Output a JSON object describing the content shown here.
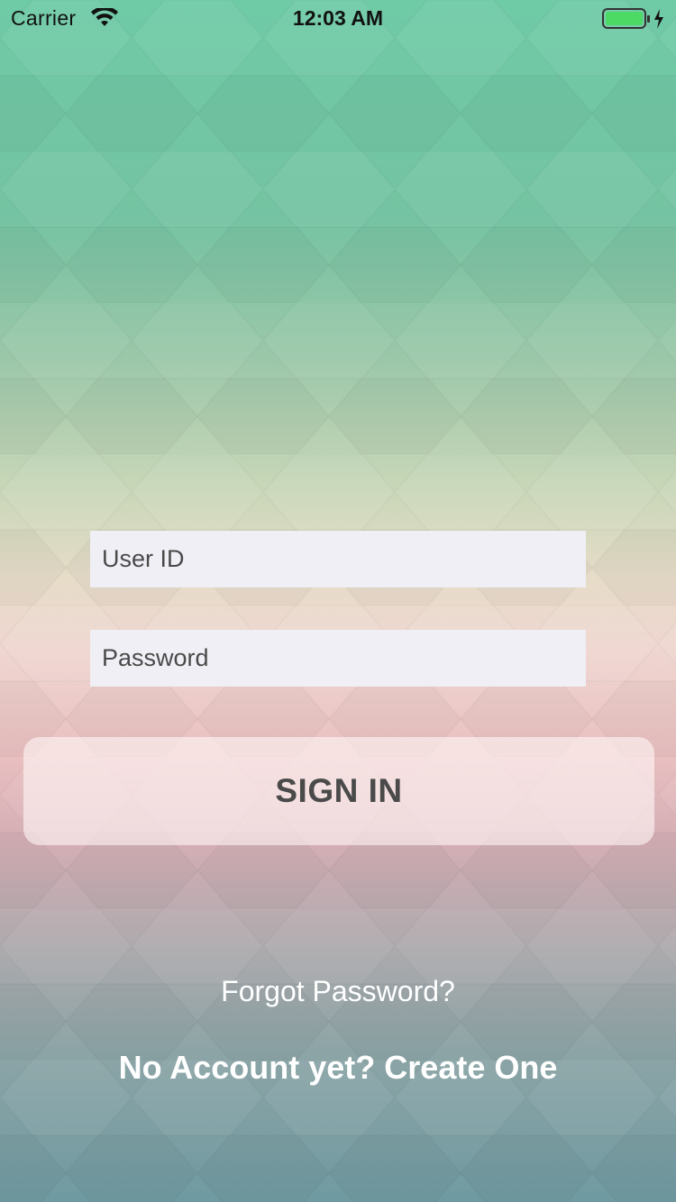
{
  "status_bar": {
    "carrier": "Carrier",
    "time": "12:03 AM",
    "wifi_icon": "wifi-icon",
    "battery_icon": "battery-charging-icon",
    "battery_color": "#4cd964"
  },
  "login": {
    "user_id_placeholder": "User ID",
    "password_placeholder": "Password",
    "sign_in_label": "SIGN IN",
    "forgot_password_label": "Forgot Password?",
    "create_account_label": "No Account yet? Create One"
  },
  "colors": {
    "field_background": "#f0eff5",
    "button_text": "#4a4a4a",
    "link_text": "#ffffff"
  }
}
